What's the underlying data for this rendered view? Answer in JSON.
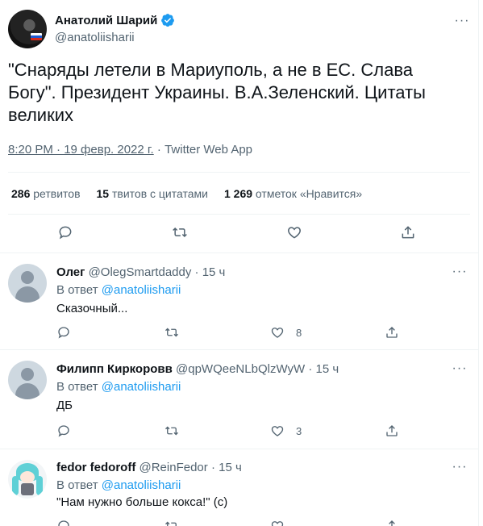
{
  "main_tweet": {
    "author_name": "Анатолий Шарий",
    "author_handle": "@anatoliisharii",
    "text": "\"Снаряды летели в Мариуполь, а не в ЕС. Слава Богу\". Президент Украины. В.А.Зеленский. Цитаты великих",
    "timestamp": "8:20 PM · 19 февр. 2022 г.",
    "separator": "·",
    "source": "Twitter Web App",
    "stats": {
      "retweets_count": "286",
      "retweets_label": "ретвитов",
      "quotes_count": "15",
      "quotes_label": "твитов с цитатами",
      "likes_count": "1 269",
      "likes_label": "отметок «Нравится»"
    }
  },
  "replies": [
    {
      "name": "Олег",
      "handle": "@OlegSmartdaddy",
      "time": "· 15 ч",
      "reply_prefix": "В ответ",
      "reply_to": "@anatoliisharii",
      "text": "Сказочный...",
      "likes": "8"
    },
    {
      "name": "Филипп Киркоровв",
      "handle": "@qpWQeeNLbQlzWyW",
      "time": "· 15 ч",
      "reply_prefix": "В ответ",
      "reply_to": "@anatoliisharii",
      "text": "ДБ",
      "likes": "3"
    },
    {
      "name": "fedor fedoroff",
      "handle": "@ReinFedor",
      "time": "· 15 ч",
      "reply_prefix": "В ответ",
      "reply_to": "@anatoliisharii",
      "text": "\"Нам нужно больше кокса!\" (с)",
      "likes": ""
    }
  ],
  "colors": {
    "accent": "#1d9bf0",
    "muted": "#536471",
    "divider": "#eff3f4"
  }
}
